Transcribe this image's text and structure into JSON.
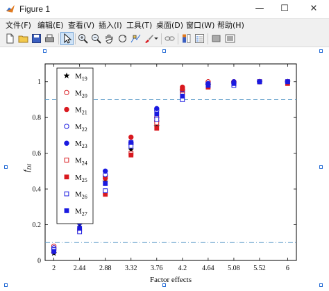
{
  "window": {
    "title": "Figure 1",
    "minimize": "—",
    "maximize": "☐",
    "close": "✕"
  },
  "menubar": {
    "items": [
      "文件(F)",
      "编辑(E)",
      "查看(V)",
      "插入(I)",
      "工具(T)",
      "桌面(D)",
      "窗口(W)",
      "帮助(H)"
    ]
  },
  "toolbar": {
    "icons": [
      "new-figure-icon",
      "open-file-icon",
      "save-icon",
      "print-icon",
      "pointer-icon",
      "zoom-in-icon",
      "zoom-out-icon",
      "pan-icon",
      "rotate-icon",
      "data-cursor-icon",
      "brush-icon",
      "brush-dropdown-icon",
      "link-icon",
      "colorbar-icon",
      "legend-icon",
      "hide-plot-tools-icon",
      "show-plot-tools-icon"
    ]
  },
  "colors": {
    "red": "#d9191f",
    "blue": "#1a1ae0",
    "black": "#000000",
    "refline": "#5a9ac8",
    "highlight": "#2a6fd6"
  },
  "chart_data": {
    "type": "scatter",
    "xlabel": "Factor effects",
    "ylabel": "f",
    "ylabel_sub": "DI",
    "x": [
      2,
      2.44,
      2.88,
      3.32,
      3.76,
      4.2,
      4.64,
      5.08,
      5.52,
      6
    ],
    "x_tick_labels": [
      "2",
      "2.44",
      "2.88",
      "3.32",
      "3.76",
      "4.2",
      "4.64",
      "5.08",
      "5.52",
      "6"
    ],
    "ylim": [
      0,
      1.1
    ],
    "y_ticks": [
      0,
      0.2,
      0.4,
      0.6,
      0.8,
      1
    ],
    "y_tick_labels": [
      "0",
      "0.2",
      "0.4",
      "0.6",
      "0.8",
      "1"
    ],
    "reference_lines": [
      {
        "y": 0.9,
        "style": "dashed"
      },
      {
        "y": 0.1,
        "style": "dash-dot"
      }
    ],
    "legend_position": "top-left",
    "series": [
      {
        "name": "M",
        "sub": "19",
        "marker": "star",
        "color": "#000000",
        "values": [
          0.04,
          0.2,
          0.44,
          0.62,
          0.75,
          0.95,
          0.98,
          0.99,
          1.0,
          1.0
        ]
      },
      {
        "name": "M",
        "sub": "20",
        "marker": "circle-open",
        "color": "#d9191f",
        "values": [
          0.08,
          0.28,
          0.47,
          0.66,
          0.8,
          0.96,
          1.0,
          1.0,
          1.0,
          1.0
        ]
      },
      {
        "name": "M",
        "sub": "21",
        "marker": "circle-filled",
        "color": "#d9191f",
        "values": [
          0.07,
          0.24,
          0.46,
          0.69,
          0.78,
          0.97,
          0.99,
          1.0,
          1.0,
          1.0
        ]
      },
      {
        "name": "M",
        "sub": "22",
        "marker": "circle-open",
        "color": "#1a1ae0",
        "values": [
          0.07,
          0.26,
          0.48,
          0.65,
          0.84,
          0.95,
          0.99,
          0.99,
          1.0,
          1.0
        ]
      },
      {
        "name": "M",
        "sub": "23",
        "marker": "circle-filled",
        "color": "#1a1ae0",
        "values": [
          0.06,
          0.21,
          0.5,
          0.66,
          0.85,
          0.94,
          0.99,
          1.0,
          1.0,
          1.0
        ]
      },
      {
        "name": "M",
        "sub": "24",
        "marker": "square-open",
        "color": "#d9191f",
        "values": [
          0.05,
          0.17,
          0.38,
          0.6,
          0.77,
          0.93,
          0.98,
          0.99,
          1.0,
          1.0
        ]
      },
      {
        "name": "M",
        "sub": "25",
        "marker": "square-filled",
        "color": "#d9191f",
        "values": [
          0.05,
          0.23,
          0.37,
          0.59,
          0.74,
          0.96,
          0.97,
          0.99,
          1.0,
          0.99
        ]
      },
      {
        "name": "M",
        "sub": "26",
        "marker": "square-open",
        "color": "#1a1ae0",
        "values": [
          0.06,
          0.16,
          0.39,
          0.64,
          0.79,
          0.9,
          0.98,
          0.98,
          1.0,
          1.0
        ]
      },
      {
        "name": "M",
        "sub": "27",
        "marker": "square-filled",
        "color": "#1a1ae0",
        "values": [
          0.05,
          0.18,
          0.43,
          0.66,
          0.82,
          0.92,
          0.98,
          0.99,
          1.0,
          1.0
        ]
      }
    ]
  }
}
